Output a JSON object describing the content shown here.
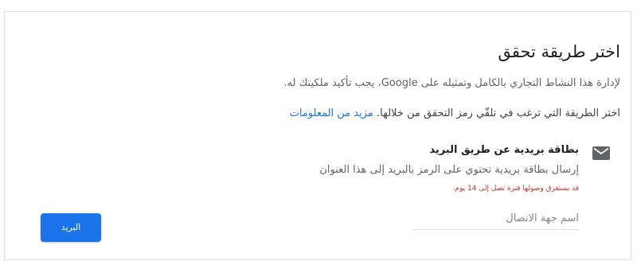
{
  "verification": {
    "title": "اختر طريقة تحقق",
    "intro": "لإدارة هذا النشاط التجاري بالكامل وتمثيله على Google، يجب تأكيد ملكيتك له.",
    "choose_text": "اختر الطريقة التي ترغب في تلقّي رمز التحقق من خلالها.",
    "learn_more": "مزيد من المعلومات"
  },
  "method": {
    "icon": "mail-icon",
    "title": "بطاقة بريدية عن طريق البريد",
    "description": "إرسال بطاقة بريدية تحتوي على الرمز بالبريد إلى هذا العنوان",
    "note": "قد يستغرق وصولها فترة تصل إلى 14 يوم.",
    "contact_placeholder": "اسم جهة الاتصال"
  },
  "actions": {
    "mail_button": "البريد"
  },
  "colors": {
    "accent": "#1a73e8",
    "note": "#d93025",
    "border": "#dadce0"
  }
}
